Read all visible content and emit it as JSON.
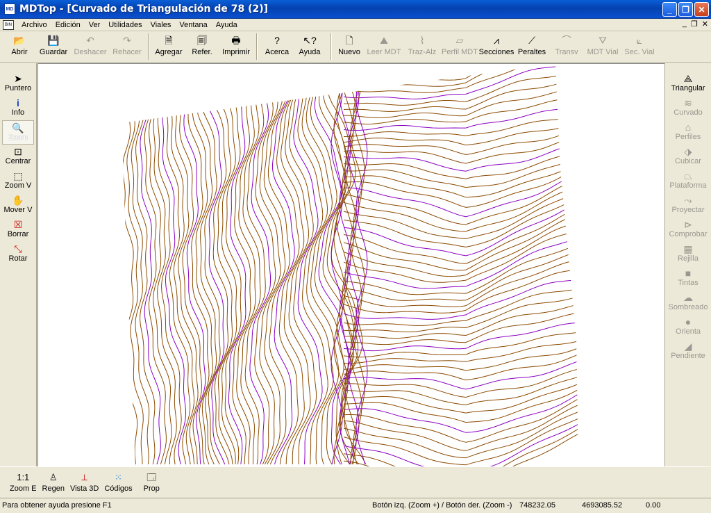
{
  "window": {
    "title": "MDTop - [Curvado de Triangulación de 78 (2)]",
    "min": "_",
    "max": "❐",
    "close": "✕"
  },
  "menu": {
    "items": [
      "Archivo",
      "Edición",
      "Ver",
      "Utilidades",
      "Viales",
      "Ventana",
      "Ayuda"
    ],
    "mdi": {
      "min": "_",
      "restore": "❐",
      "close": "✕"
    }
  },
  "toolbar": {
    "abrir": "Abrir",
    "guardar": "Guardar",
    "deshacer": "Deshacer",
    "rehacer": "Rehacer",
    "agregar": "Agregar",
    "refer": "Refer.",
    "imprimir": "Imprimir",
    "acerca": "Acerca",
    "ayuda": "Ayuda",
    "nuevo": "Nuevo",
    "leer_mdt": "Leer MDT",
    "traz_alz": "Traz-Alz",
    "perfil_mdt": "Perfil MDT",
    "secciones": "Secciones",
    "peraltes": "Peraltes",
    "transv": "Transv",
    "mdt_vial": "MDT Vial",
    "sec_vial": "Sec. Vial"
  },
  "left_tools": {
    "puntero": "Puntero",
    "info": "Info",
    "zoom": "Zoom",
    "centrar": "Centrar",
    "zoom_v": "Zoom V",
    "mover_v": "Mover V",
    "borrar": "Borrar",
    "rotar": "Rotar"
  },
  "right_tools": {
    "triangular": "Triangular",
    "curvado": "Curvado",
    "perfiles": "Perfiles",
    "cubicar": "Cubicar",
    "plataforma": "Plataforma",
    "proyectar": "Proyectar",
    "comprobar": "Comprobar",
    "rejilla": "Rejilla",
    "tintas": "Tintas",
    "sombreado": "Sombreado",
    "orienta": "Orienta",
    "pendiente": "Pendiente"
  },
  "bottom_tools": {
    "zoom_e_icon": "1:1",
    "zoom_e": "Zoom E",
    "regen": "Regen",
    "vista3d": "Vista 3D",
    "codigos": "Códigos",
    "prop": "Prop"
  },
  "status": {
    "help": "Para obtener ayuda presione F1",
    "mouse": "Botón izq. (Zoom +) / Botón der. (Zoom -)",
    "x": "748232.05",
    "y": "4693085.52",
    "z": "0.00"
  },
  "colors": {
    "contour_main": "#8b4a00",
    "contour_index": "#8a00c0",
    "titlebar": "#0a4fd0"
  }
}
